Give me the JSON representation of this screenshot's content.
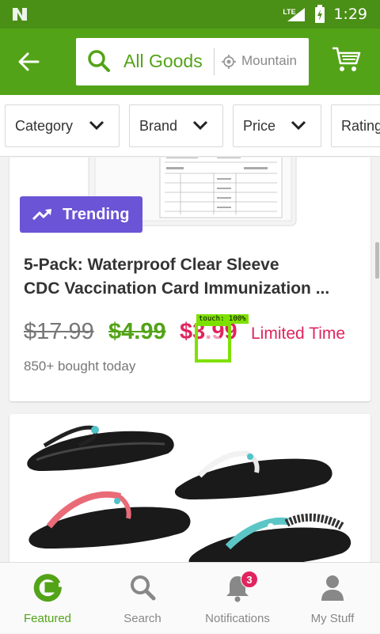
{
  "status_bar": {
    "network": "LTE",
    "time": "1:29"
  },
  "header": {
    "search_query": "All Goods",
    "location": "Mountain"
  },
  "filters": [
    {
      "label": "Category"
    },
    {
      "label": "Brand"
    },
    {
      "label": "Price"
    },
    {
      "label": "Rating"
    }
  ],
  "deal": {
    "badge": "Trending",
    "title_line1": "5-Pack: Waterproof Clear Sleeve",
    "title_line2": "CDC Vaccination Card Immunization ...",
    "old_price": "$17.99",
    "new_price": "$4.99",
    "deal_price": "$3.99",
    "limited_label": "Limited Time",
    "bought": "850+ bought today"
  },
  "touch_overlay": {
    "label": "touch: 100%"
  },
  "bottom_nav": {
    "items": [
      {
        "label": "Featured",
        "icon": "groupon-g-icon",
        "active": true
      },
      {
        "label": "Search",
        "icon": "search-icon",
        "active": false
      },
      {
        "label": "Notifications",
        "icon": "bell-icon",
        "active": false
      },
      {
        "label": "My Stuff",
        "icon": "person-icon",
        "active": false
      }
    ],
    "notification_count": "3"
  },
  "colors": {
    "brand_green": "#53a318",
    "status_green": "#4a8f16",
    "trending_purple": "#6b54d6",
    "deal_red": "#e0245e"
  }
}
